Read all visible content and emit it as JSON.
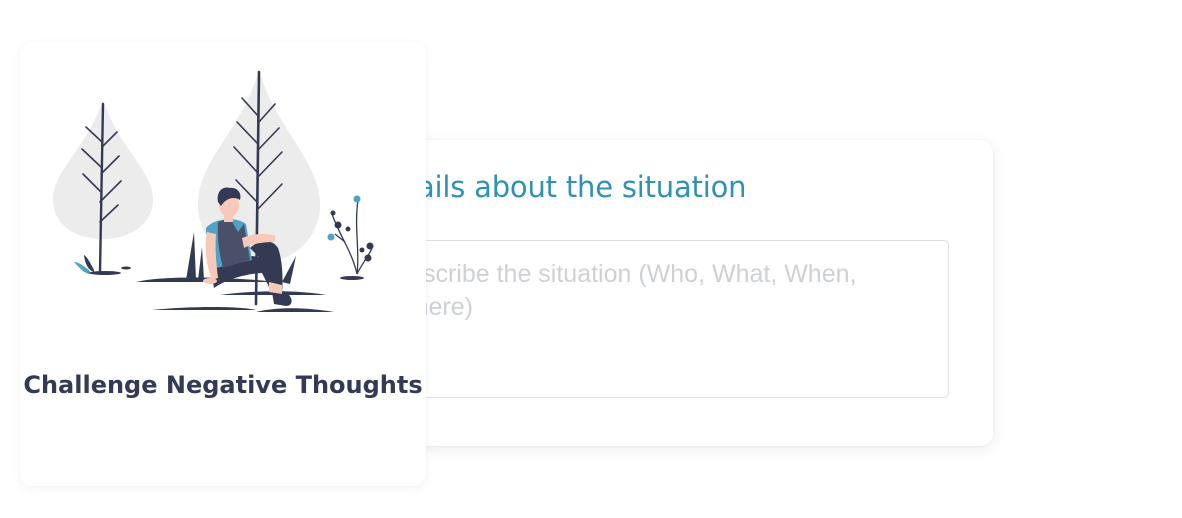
{
  "situation_form": {
    "heading": "Details about the situation",
    "situation_placeholder": "Describe the situation (Who, What, When, Where)",
    "situation_value": ""
  },
  "exercise_card": {
    "title": "Challenge Negative Thoughts",
    "illustration": "person-sitting-under-trees-illustration"
  },
  "colors": {
    "heading": "#3191b3",
    "title": "#343a53",
    "placeholder": "#cdd1d6",
    "accent_blue": "#4fa3c4"
  }
}
